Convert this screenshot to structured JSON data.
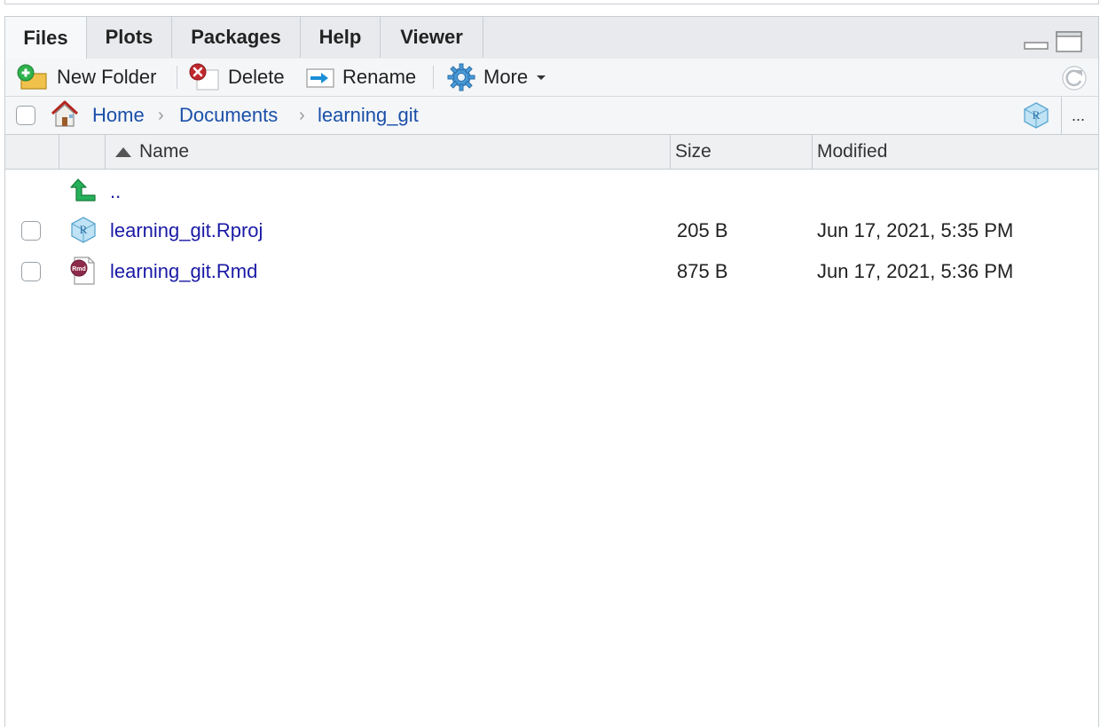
{
  "tabs": [
    {
      "label": "Files",
      "active": true
    },
    {
      "label": "Plots",
      "active": false
    },
    {
      "label": "Packages",
      "active": false
    },
    {
      "label": "Help",
      "active": false
    },
    {
      "label": "Viewer",
      "active": false
    }
  ],
  "toolbar": {
    "new_folder": "New Folder",
    "delete": "Delete",
    "rename": "Rename",
    "more": "More"
  },
  "breadcrumb": {
    "items": [
      "Home",
      "Documents",
      "learning_git"
    ],
    "overflow": "..."
  },
  "table": {
    "columns": [
      "Name",
      "Size",
      "Modified"
    ],
    "parent_label": "..",
    "rows": [
      {
        "name": "learning_git.Rproj",
        "size": "205 B",
        "modified": "Jun 17, 2021, 5:35 PM",
        "icon": "rproj-icon"
      },
      {
        "name": "learning_git.Rmd",
        "size": "875 B",
        "modified": "Jun 17, 2021, 5:36 PM",
        "icon": "rmd-icon"
      }
    ]
  },
  "colors": {
    "link": "#1a1aa6",
    "breadcrumb": "#1a4fa8",
    "tabbar": "#e8eaed",
    "toolbar": "#f4f6f8"
  }
}
